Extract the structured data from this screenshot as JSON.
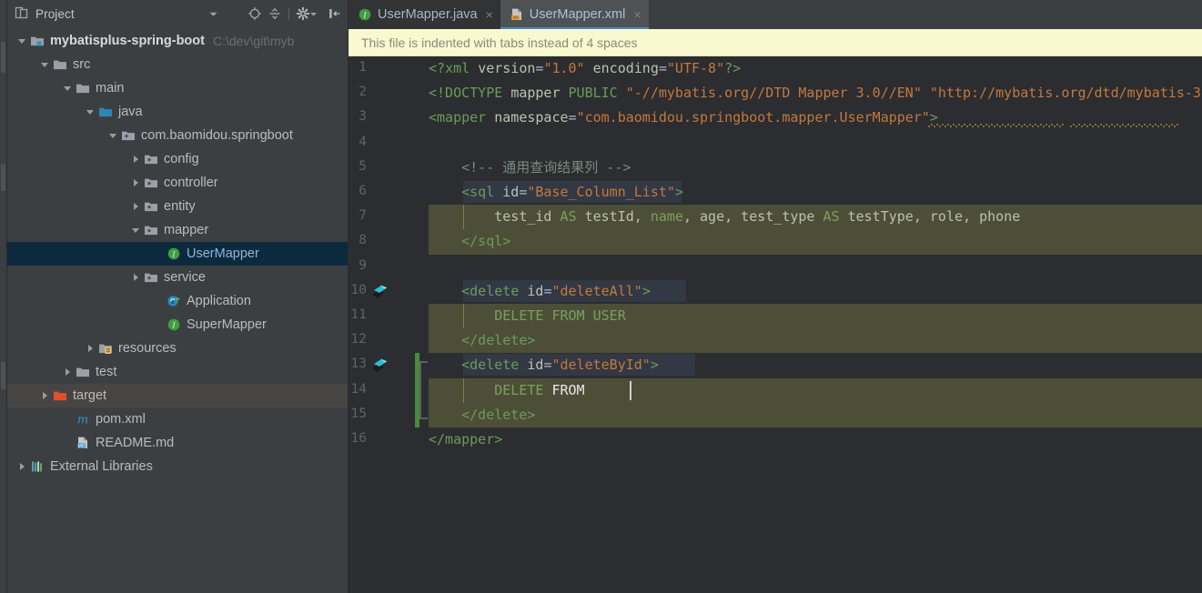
{
  "project_pane": {
    "title": "Project",
    "toolbar": [
      {
        "name": "locate-icon",
        "label": "Locate"
      },
      {
        "name": "collapse-all-icon",
        "label": "Collapse All"
      },
      {
        "name": "settings-gear-icon",
        "label": "Settings"
      },
      {
        "name": "hide-panel-icon",
        "label": "Hide"
      }
    ],
    "dropdown_label": "Project view selector",
    "tree": [
      {
        "label": "mybatisplus-spring-boot",
        "sub": "C:\\dev\\git\\myb",
        "depth": 0,
        "arrow": "down",
        "icon": "module-folder-icon",
        "bold": true,
        "state": "normal"
      },
      {
        "label": "src",
        "sub": "",
        "depth": 1,
        "arrow": "down",
        "icon": "folder-icon",
        "bold": false,
        "state": "normal"
      },
      {
        "label": "main",
        "sub": "",
        "depth": 2,
        "arrow": "down",
        "icon": "folder-icon",
        "bold": false,
        "state": "normal"
      },
      {
        "label": "java",
        "sub": "",
        "depth": 3,
        "arrow": "down",
        "icon": "source-root-icon",
        "bold": false,
        "state": "normal"
      },
      {
        "label": "com.baomidou.springboot",
        "sub": "",
        "depth": 4,
        "arrow": "down",
        "icon": "package-icon",
        "bold": false,
        "state": "normal"
      },
      {
        "label": "config",
        "sub": "",
        "depth": 5,
        "arrow": "right",
        "icon": "package-icon",
        "bold": false,
        "state": "normal"
      },
      {
        "label": "controller",
        "sub": "",
        "depth": 5,
        "arrow": "right",
        "icon": "package-icon",
        "bold": false,
        "state": "normal"
      },
      {
        "label": "entity",
        "sub": "",
        "depth": 5,
        "arrow": "right",
        "icon": "package-icon",
        "bold": false,
        "state": "normal"
      },
      {
        "label": "mapper",
        "sub": "",
        "depth": 5,
        "arrow": "down",
        "icon": "package-icon",
        "bold": false,
        "state": "normal"
      },
      {
        "label": "UserMapper",
        "sub": "",
        "depth": 6,
        "arrow": "none",
        "icon": "interface-icon",
        "bold": false,
        "state": "selected"
      },
      {
        "label": "service",
        "sub": "",
        "depth": 5,
        "arrow": "right",
        "icon": "package-icon",
        "bold": false,
        "state": "normal"
      },
      {
        "label": "Application",
        "sub": "",
        "depth": 6,
        "arrow": "none",
        "icon": "spring-run-icon",
        "bold": false,
        "state": "normal"
      },
      {
        "label": "SuperMapper",
        "sub": "",
        "depth": 6,
        "arrow": "none",
        "icon": "interface-icon",
        "bold": false,
        "state": "normal"
      },
      {
        "label": "resources",
        "sub": "",
        "depth": 3,
        "arrow": "right",
        "icon": "resource-root-icon",
        "bold": false,
        "state": "normal"
      },
      {
        "label": "test",
        "sub": "",
        "depth": 2,
        "arrow": "right",
        "icon": "folder-icon",
        "bold": false,
        "state": "normal"
      },
      {
        "label": "target",
        "sub": "",
        "depth": 1,
        "arrow": "right",
        "icon": "excluded-folder-icon",
        "bold": false,
        "state": "hovered"
      },
      {
        "label": "pom.xml",
        "sub": "",
        "depth": 2,
        "arrow": "none",
        "icon": "maven-icon",
        "bold": false,
        "state": "normal"
      },
      {
        "label": "README.md",
        "sub": "",
        "depth": 2,
        "arrow": "none",
        "icon": "markdown-icon",
        "bold": false,
        "state": "normal"
      },
      {
        "label": "External Libraries",
        "sub": "",
        "depth": 0,
        "arrow": "right",
        "icon": "libraries-icon",
        "bold": false,
        "state": "normal"
      }
    ]
  },
  "editor": {
    "tabs": [
      {
        "label": "UserMapper.java",
        "icon": "java-interface-icon",
        "active": false,
        "close": "×"
      },
      {
        "label": "UserMapper.xml",
        "icon": "xml-file-icon",
        "active": true,
        "close": "×"
      }
    ],
    "notification": "This file is indented with tabs instead of 4 spaces",
    "line_numbers": [
      "1",
      "2",
      "3",
      "4",
      "5",
      "6",
      "7",
      "8",
      "9",
      "10",
      "11",
      "12",
      "13",
      "14",
      "15",
      "16"
    ],
    "gutter_icons": [
      {
        "line": 10,
        "name": "mybatis-navigate-icon"
      },
      {
        "line": 13,
        "name": "mybatis-navigate-icon"
      }
    ],
    "lines": [
      {
        "n": 1,
        "segments": [
          {
            "t": "<?",
            "c": "t-tag"
          },
          {
            "t": "xml ",
            "c": "t-tag"
          },
          {
            "t": "version",
            "c": "t-attr"
          },
          {
            "t": "=",
            "c": "t-punct"
          },
          {
            "t": "\"1.0\"",
            "c": "t-val"
          },
          {
            "t": " ",
            "c": "t-punct"
          },
          {
            "t": "encoding",
            "c": "t-attr"
          },
          {
            "t": "=",
            "c": "t-punct"
          },
          {
            "t": "\"UTF-8\"",
            "c": "t-val"
          },
          {
            "t": "?>",
            "c": "t-tag"
          }
        ]
      },
      {
        "n": 2,
        "segments": [
          {
            "t": "<!DOCTYPE ",
            "c": "t-tag"
          },
          {
            "t": "mapper ",
            "c": "t-attr"
          },
          {
            "t": "PUBLIC ",
            "c": "t-doc"
          },
          {
            "t": "\"-//mybatis.org//DTD Mapper 3.0//EN\" ",
            "c": "t-str"
          },
          {
            "t": "\"http://mybatis.org/dtd/mybatis-3",
            "c": "t-str"
          }
        ]
      },
      {
        "n": 3,
        "segments": [
          {
            "t": "<mapper ",
            "c": "t-tag"
          },
          {
            "t": "namespace",
            "c": "t-attr"
          },
          {
            "t": "=",
            "c": "t-punct"
          },
          {
            "t": "\"com.baomidou.springboot.mapper.UserMapper\"",
            "c": "t-val"
          },
          {
            "t": ">",
            "c": "t-tag"
          }
        ]
      },
      {
        "n": 4,
        "segments": []
      },
      {
        "n": 5,
        "segments": [
          {
            "t": "    <!-- 通用查询结果列 -->",
            "c": "t-comm"
          }
        ]
      },
      {
        "n": 6,
        "segments": [
          {
            "t": "    <sql ",
            "c": "t-tag"
          },
          {
            "t": "id",
            "c": "t-attr"
          },
          {
            "t": "=",
            "c": "t-punct"
          },
          {
            "t": "\"Base_Column_List\"",
            "c": "t-val"
          },
          {
            "t": ">",
            "c": "t-tag"
          }
        ]
      },
      {
        "n": 7,
        "segments": [
          {
            "t": "        test_id ",
            "c": "t-sqlid"
          },
          {
            "t": "AS",
            "c": "t-sqlkw"
          },
          {
            "t": " testId, ",
            "c": "t-sqlid"
          },
          {
            "t": "name",
            "c": "t-sqlkw"
          },
          {
            "t": ", age, test_type ",
            "c": "t-sqlid"
          },
          {
            "t": "AS",
            "c": "t-sqlkw"
          },
          {
            "t": " testType, role, phone",
            "c": "t-sqlid"
          }
        ]
      },
      {
        "n": 8,
        "segments": [
          {
            "t": "    </sql>",
            "c": "t-tag"
          }
        ]
      },
      {
        "n": 9,
        "segments": []
      },
      {
        "n": 10,
        "segments": [
          {
            "t": "    <delete ",
            "c": "t-tag"
          },
          {
            "t": "id",
            "c": "t-attr"
          },
          {
            "t": "=",
            "c": "t-punct"
          },
          {
            "t": "\"deleteAll\"",
            "c": "t-val"
          },
          {
            "t": ">",
            "c": "t-tag"
          }
        ]
      },
      {
        "n": 11,
        "segments": [
          {
            "t": "        DELETE FROM USER",
            "c": "t-sqlkw"
          }
        ]
      },
      {
        "n": 12,
        "segments": [
          {
            "t": "    </delete>",
            "c": "t-tag"
          }
        ]
      },
      {
        "n": 13,
        "segments": [
          {
            "t": "    <delete ",
            "c": "t-tag"
          },
          {
            "t": "id",
            "c": "t-attr"
          },
          {
            "t": "=",
            "c": "t-punct"
          },
          {
            "t": "\"deleteById\"",
            "c": "t-val"
          },
          {
            "t": ">",
            "c": "t-tag"
          }
        ]
      },
      {
        "n": 14,
        "segments": [
          {
            "t": "        DELETE ",
            "c": "t-sqlkw"
          },
          {
            "t": "FROM",
            "c": "t-white"
          },
          {
            "t": " ",
            "c": "t-sqlid"
          }
        ]
      },
      {
        "n": 15,
        "segments": [
          {
            "t": "    </delete>",
            "c": "t-tag"
          }
        ]
      },
      {
        "n": 16,
        "segments": [
          {
            "t": "</mapper>",
            "c": "t-tag"
          }
        ]
      }
    ],
    "injection_lines": [
      7,
      8,
      11,
      12,
      14,
      15
    ],
    "vcs_change_lines": [
      13,
      14,
      15
    ],
    "caret": {
      "line": 14,
      "column": 21
    },
    "colors": {
      "editor_bg": "#2b2d30",
      "panel_bg": "#3c3f41",
      "selection_blue": "#0d293e",
      "accent_tab": "#4a88c7",
      "notification_bg": "#f9f9cf",
      "sql_injection_bg": "#56553a",
      "vcs_added_green": "#4a8a3a"
    }
  }
}
